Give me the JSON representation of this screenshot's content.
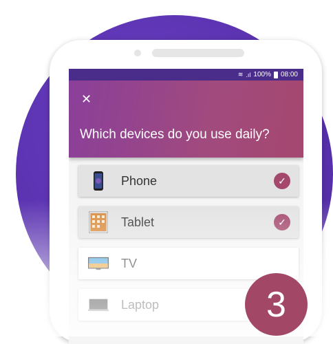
{
  "status_bar": {
    "text": "100%",
    "time": "08:00"
  },
  "app_bar": {
    "close_symbol": "✕",
    "question": "Which devices do you use daily?"
  },
  "devices": [
    {
      "label": "Phone",
      "icon": "phone-icon",
      "selected": true
    },
    {
      "label": "Tablet",
      "icon": "tablet-icon",
      "selected": true
    },
    {
      "label": "TV",
      "icon": "tv-icon",
      "selected": false
    },
    {
      "label": "Laptop",
      "icon": "laptop-icon",
      "selected": false
    }
  ],
  "step_badge": "3",
  "colors": {
    "circle": "#5a32b0",
    "accent": "#a4486c",
    "status_bar": "#4a2d8a"
  }
}
